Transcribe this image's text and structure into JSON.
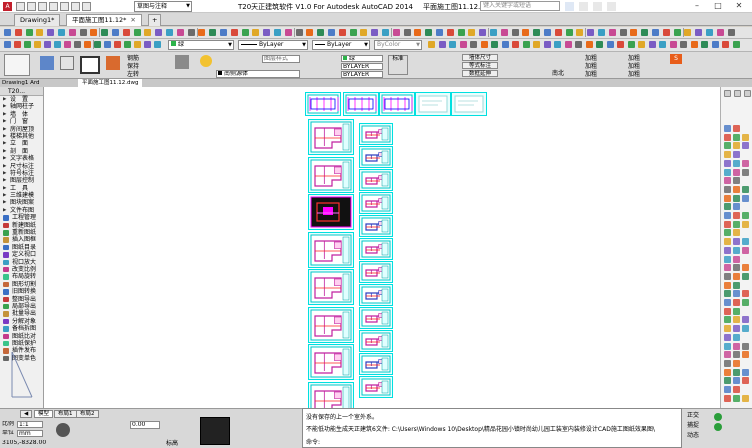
{
  "titlebar": {
    "app_title": "T20天正建筑软件 V1.0 For Autodesk AutoCAD 2014",
    "file_title": "平面施工图11.12.dwg",
    "workspace_combo": "草图与注释",
    "search_placeholder": "键入关键字或短语",
    "window_buttons": {
      "minimize": "–",
      "maximize": "□",
      "close": "✕"
    }
  },
  "doc_tabs": [
    {
      "label": "Drawing1*"
    },
    {
      "label": "平面施工图11.12*"
    }
  ],
  "toolbar2": {
    "layer_combo": "0",
    "color_combo": "ByLayer",
    "linetype_combo": "ByLayer",
    "lineweight_combo": "ByColor",
    "green_label": "绿"
  },
  "panel": {
    "ribbon_labels": [
      "钢筋",
      "保持",
      "左转"
    ],
    "style_combo": "图层样式",
    "furniture_combo": "天正图层",
    "standard_label": "标准",
    "layer_sm_1": "绿",
    "layer_sm_2": "BYLAYER",
    "layer_sm_3": "BYLAYER",
    "btns": [
      "墙体尺寸",
      "等式标注",
      "数框延伸"
    ],
    "right_labels": [
      "加粗",
      "加粗",
      "加粗"
    ],
    "dim_label": "南北",
    "anno_combo": "南侧源体"
  },
  "draw_tabs": {
    "model_label": "Drawing1 Ard",
    "doc_label": "平面施工图11.12.dwg"
  },
  "palette": {
    "header": "T20...",
    "items": [
      {
        "label": "设　置",
        "kind": "menu"
      },
      {
        "label": "轴网柱子",
        "kind": "menu"
      },
      {
        "label": "墙　体",
        "kind": "menu"
      },
      {
        "label": "门　窗",
        "kind": "menu"
      },
      {
        "label": "房间屋顶",
        "kind": "menu"
      },
      {
        "label": "楼梯其他",
        "kind": "menu"
      },
      {
        "label": "立　面",
        "kind": "menu"
      },
      {
        "label": "剖　面",
        "kind": "menu"
      },
      {
        "label": "文字表格",
        "kind": "menu"
      },
      {
        "label": "尺寸标注",
        "kind": "menu"
      },
      {
        "label": "符号标注",
        "kind": "menu"
      },
      {
        "label": "图层控制",
        "kind": "menu"
      },
      {
        "label": "工　具",
        "kind": "menu"
      },
      {
        "label": "三维建模",
        "kind": "menu"
      },
      {
        "label": "图块图案",
        "kind": "menu"
      },
      {
        "label": "文件布图",
        "kind": "menu"
      },
      {
        "label": "工程管理",
        "kind": "sub",
        "color": "#3a6fc4"
      },
      {
        "label": "新建图纸",
        "kind": "sub",
        "color": "#c43a3a"
      },
      {
        "label": "重新图纸",
        "kind": "sub",
        "color": "#3aa24f"
      },
      {
        "label": "插入图框",
        "kind": "sub",
        "color": "#c4933a"
      },
      {
        "label": "图纸目录",
        "kind": "sub",
        "color": "#3a6fc4"
      },
      {
        "label": "定义视口",
        "kind": "sub",
        "color": "#7a3ac4"
      },
      {
        "label": "视口放大",
        "kind": "sub",
        "color": "#3a9fc4"
      },
      {
        "label": "改变比例",
        "kind": "sub",
        "color": "#c43a8c"
      },
      {
        "label": "布局旋转",
        "kind": "sub",
        "color": "#3ac48a"
      },
      {
        "label": "图形切割",
        "kind": "sub",
        "color": "#c4673a"
      },
      {
        "label": "旧图转换",
        "kind": "sub",
        "color": "#3a6fc4"
      },
      {
        "label": "整图导出",
        "kind": "sub",
        "color": "#c43a3a"
      },
      {
        "label": "局部导出",
        "kind": "sub",
        "color": "#3aa24f"
      },
      {
        "label": "批量导出",
        "kind": "sub",
        "color": "#c4933a"
      },
      {
        "label": "分解对象",
        "kind": "sub",
        "color": "#7a3ac4"
      },
      {
        "label": "备档拆图",
        "kind": "sub",
        "color": "#3a9fc4"
      },
      {
        "label": "图纸比对",
        "kind": "sub",
        "color": "#c43a8c"
      },
      {
        "label": "图纸保护",
        "kind": "sub",
        "color": "#3ac48a"
      },
      {
        "label": "插件发布",
        "kind": "sub",
        "color": "#c4673a"
      },
      {
        "label": "图变单色",
        "kind": "sub",
        "color": "#666666"
      }
    ]
  },
  "layout_tabs": [
    "模型",
    "布局1",
    "布局2"
  ],
  "bottom": {
    "scale_label": "比例",
    "scale_value": "1:1",
    "unit_label": "单位",
    "unit_value": "mm",
    "coords": "3105,-8328.00",
    "elev_label": "0.00",
    "base_label": "标高"
  },
  "command": {
    "lines": [
      "没有保存的上一个室外系。",
      "不能低功能生成天正建筑6文件: C:\\Users\\Windows 10\\Desktop\\精品花园小镇时尚幼儿园工装室内装修设计CAD施工图纸效果图\\",
      "命令:"
    ]
  },
  "status_right": {
    "items": [
      "正交",
      "捕捉",
      "动态"
    ]
  },
  "colors": {
    "cyan": "#00e0e0",
    "magenta": "#ff00ff",
    "red": "#ff0000",
    "blue": "#0000ff",
    "dark": "#1a1a1a"
  }
}
